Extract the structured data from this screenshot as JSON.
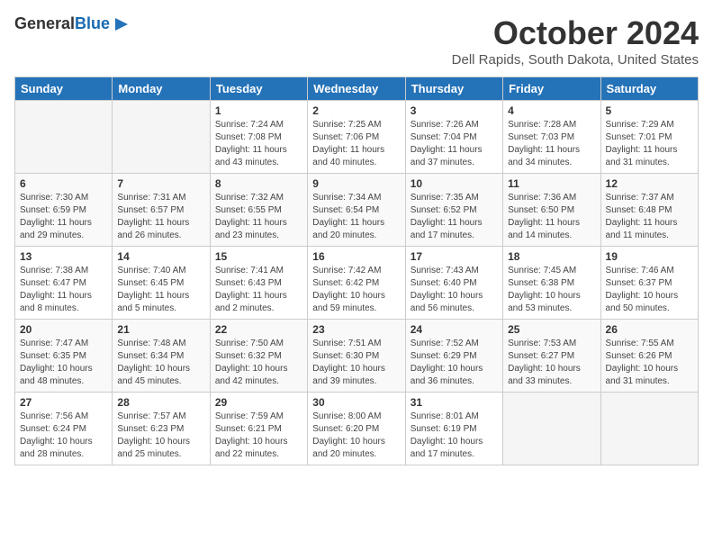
{
  "header": {
    "logo_general": "General",
    "logo_blue": "Blue",
    "month": "October 2024",
    "location": "Dell Rapids, South Dakota, United States"
  },
  "days_of_week": [
    "Sunday",
    "Monday",
    "Tuesday",
    "Wednesday",
    "Thursday",
    "Friday",
    "Saturday"
  ],
  "weeks": [
    [
      {
        "num": "",
        "info": ""
      },
      {
        "num": "",
        "info": ""
      },
      {
        "num": "1",
        "info": "Sunrise: 7:24 AM\nSunset: 7:08 PM\nDaylight: 11 hours and 43 minutes."
      },
      {
        "num": "2",
        "info": "Sunrise: 7:25 AM\nSunset: 7:06 PM\nDaylight: 11 hours and 40 minutes."
      },
      {
        "num": "3",
        "info": "Sunrise: 7:26 AM\nSunset: 7:04 PM\nDaylight: 11 hours and 37 minutes."
      },
      {
        "num": "4",
        "info": "Sunrise: 7:28 AM\nSunset: 7:03 PM\nDaylight: 11 hours and 34 minutes."
      },
      {
        "num": "5",
        "info": "Sunrise: 7:29 AM\nSunset: 7:01 PM\nDaylight: 11 hours and 31 minutes."
      }
    ],
    [
      {
        "num": "6",
        "info": "Sunrise: 7:30 AM\nSunset: 6:59 PM\nDaylight: 11 hours and 29 minutes."
      },
      {
        "num": "7",
        "info": "Sunrise: 7:31 AM\nSunset: 6:57 PM\nDaylight: 11 hours and 26 minutes."
      },
      {
        "num": "8",
        "info": "Sunrise: 7:32 AM\nSunset: 6:55 PM\nDaylight: 11 hours and 23 minutes."
      },
      {
        "num": "9",
        "info": "Sunrise: 7:34 AM\nSunset: 6:54 PM\nDaylight: 11 hours and 20 minutes."
      },
      {
        "num": "10",
        "info": "Sunrise: 7:35 AM\nSunset: 6:52 PM\nDaylight: 11 hours and 17 minutes."
      },
      {
        "num": "11",
        "info": "Sunrise: 7:36 AM\nSunset: 6:50 PM\nDaylight: 11 hours and 14 minutes."
      },
      {
        "num": "12",
        "info": "Sunrise: 7:37 AM\nSunset: 6:48 PM\nDaylight: 11 hours and 11 minutes."
      }
    ],
    [
      {
        "num": "13",
        "info": "Sunrise: 7:38 AM\nSunset: 6:47 PM\nDaylight: 11 hours and 8 minutes."
      },
      {
        "num": "14",
        "info": "Sunrise: 7:40 AM\nSunset: 6:45 PM\nDaylight: 11 hours and 5 minutes."
      },
      {
        "num": "15",
        "info": "Sunrise: 7:41 AM\nSunset: 6:43 PM\nDaylight: 11 hours and 2 minutes."
      },
      {
        "num": "16",
        "info": "Sunrise: 7:42 AM\nSunset: 6:42 PM\nDaylight: 10 hours and 59 minutes."
      },
      {
        "num": "17",
        "info": "Sunrise: 7:43 AM\nSunset: 6:40 PM\nDaylight: 10 hours and 56 minutes."
      },
      {
        "num": "18",
        "info": "Sunrise: 7:45 AM\nSunset: 6:38 PM\nDaylight: 10 hours and 53 minutes."
      },
      {
        "num": "19",
        "info": "Sunrise: 7:46 AM\nSunset: 6:37 PM\nDaylight: 10 hours and 50 minutes."
      }
    ],
    [
      {
        "num": "20",
        "info": "Sunrise: 7:47 AM\nSunset: 6:35 PM\nDaylight: 10 hours and 48 minutes."
      },
      {
        "num": "21",
        "info": "Sunrise: 7:48 AM\nSunset: 6:34 PM\nDaylight: 10 hours and 45 minutes."
      },
      {
        "num": "22",
        "info": "Sunrise: 7:50 AM\nSunset: 6:32 PM\nDaylight: 10 hours and 42 minutes."
      },
      {
        "num": "23",
        "info": "Sunrise: 7:51 AM\nSunset: 6:30 PM\nDaylight: 10 hours and 39 minutes."
      },
      {
        "num": "24",
        "info": "Sunrise: 7:52 AM\nSunset: 6:29 PM\nDaylight: 10 hours and 36 minutes."
      },
      {
        "num": "25",
        "info": "Sunrise: 7:53 AM\nSunset: 6:27 PM\nDaylight: 10 hours and 33 minutes."
      },
      {
        "num": "26",
        "info": "Sunrise: 7:55 AM\nSunset: 6:26 PM\nDaylight: 10 hours and 31 minutes."
      }
    ],
    [
      {
        "num": "27",
        "info": "Sunrise: 7:56 AM\nSunset: 6:24 PM\nDaylight: 10 hours and 28 minutes."
      },
      {
        "num": "28",
        "info": "Sunrise: 7:57 AM\nSunset: 6:23 PM\nDaylight: 10 hours and 25 minutes."
      },
      {
        "num": "29",
        "info": "Sunrise: 7:59 AM\nSunset: 6:21 PM\nDaylight: 10 hours and 22 minutes."
      },
      {
        "num": "30",
        "info": "Sunrise: 8:00 AM\nSunset: 6:20 PM\nDaylight: 10 hours and 20 minutes."
      },
      {
        "num": "31",
        "info": "Sunrise: 8:01 AM\nSunset: 6:19 PM\nDaylight: 10 hours and 17 minutes."
      },
      {
        "num": "",
        "info": ""
      },
      {
        "num": "",
        "info": ""
      }
    ]
  ]
}
